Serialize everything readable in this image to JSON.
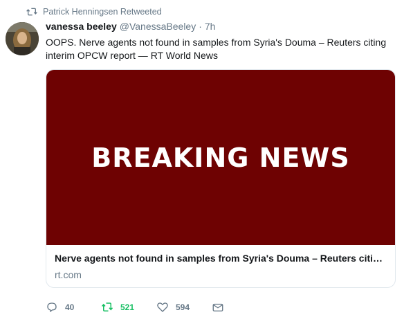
{
  "retweet_context": {
    "icon": "retweet-icon",
    "text": "Patrick Henningsen Retweeted"
  },
  "author": {
    "display_name": "vanessa beeley",
    "handle": "@VanessaBeeley",
    "separator": "·",
    "timestamp": "7h",
    "avatar": "avatar-photo"
  },
  "tweet": {
    "text": "OOPS. Nerve agents not found in samples from Syria's Douma – Reuters citing interim OPCW report — RT World News"
  },
  "card": {
    "image_text": "BREAKING NEWS",
    "image_background": "#6e0202",
    "title": "Nerve agents not found in samples from Syria's Douma – Reuters citing interim OPCW report",
    "domain": "rt.com"
  },
  "actions": {
    "reply_count": "40",
    "retweet_count": "521",
    "like_count": "594",
    "retweet_active_color": "#17bf63",
    "icons": [
      "reply-icon",
      "retweet-icon",
      "like-icon",
      "direct-message-icon"
    ]
  }
}
